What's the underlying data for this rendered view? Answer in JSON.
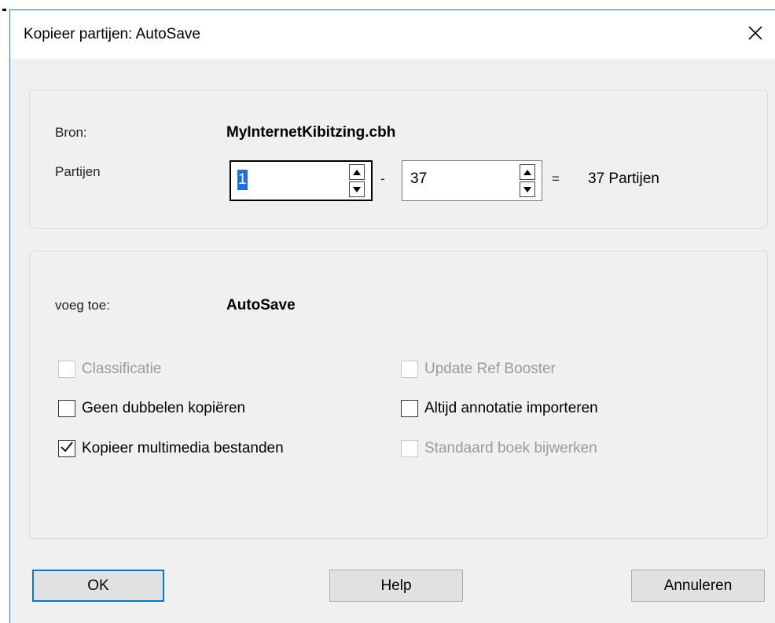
{
  "window": {
    "title": "Kopieer partijen: AutoSave",
    "close_icon": "close-icon"
  },
  "source_group": {
    "source_label": "Bron:",
    "source_value": "MyInternetKibitzing.cbh",
    "games_label": "Partijen",
    "range_from": "1",
    "range_separator": "-",
    "range_to": "37",
    "equals": "=",
    "count_text": "37 Partijen"
  },
  "target_group": {
    "append_label": "voeg toe:",
    "append_value": "AutoSave",
    "options": {
      "classificatie": {
        "label": "Classificatie",
        "checked": false,
        "enabled": false
      },
      "update_ref_booster": {
        "label": "Update Ref Booster",
        "checked": false,
        "enabled": false
      },
      "geen_dubbelen": {
        "label": "Geen dubbelen kopiëren",
        "checked": false,
        "enabled": true
      },
      "altijd_annotatie": {
        "label": "Altijd annotatie importeren",
        "checked": false,
        "enabled": true
      },
      "kopieer_multimedia": {
        "label": "Kopieer multimedia bestanden",
        "checked": true,
        "enabled": true
      },
      "standaard_boek": {
        "label": "Standaard boek bijwerken",
        "checked": false,
        "enabled": false
      }
    }
  },
  "buttons": {
    "ok": "OK",
    "help": "Help",
    "cancel": "Annuleren"
  },
  "colors": {
    "accent": "#0078d7",
    "selection": "#1e6fd9",
    "disabled_text": "#9b9b9b",
    "dialog_bg": "#f0f0f0"
  }
}
